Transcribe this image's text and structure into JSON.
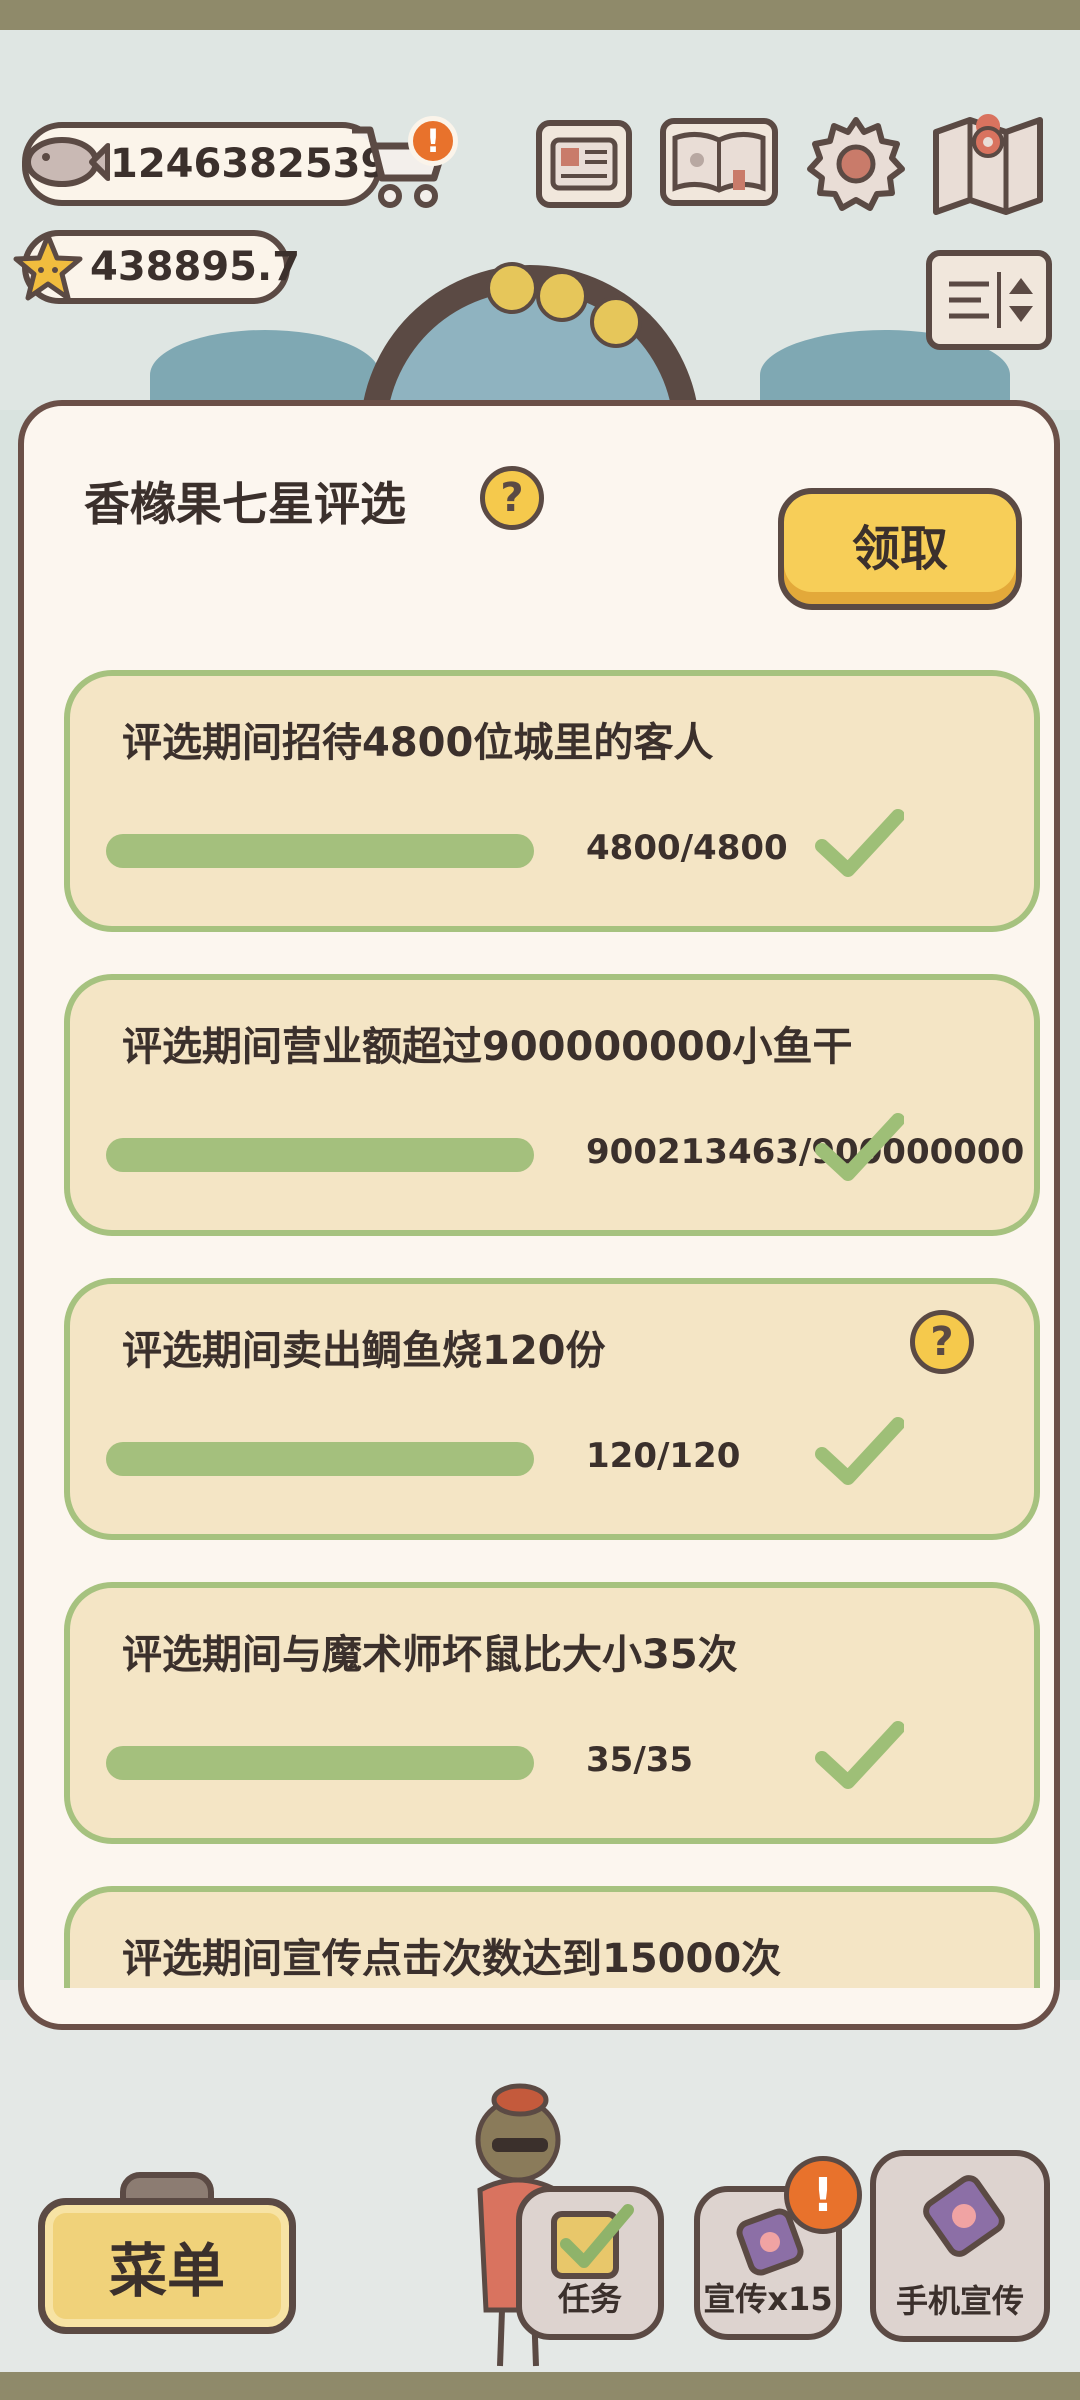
{
  "hud": {
    "fish_count": "1246382539",
    "star_count": "438895.7",
    "cart_alert": "!"
  },
  "icons": {
    "top_buttons": [
      "newspaper-icon",
      "album-icon",
      "settings-icon",
      "map-icon"
    ],
    "layout_toggle": "layout-toggle-icon"
  },
  "modal": {
    "title": "香橼果七星评选",
    "help": "?",
    "claim_label": "领取",
    "tasks": [
      {
        "title": "评选期间招待4800位城里的客人",
        "progress_text": "4800/4800",
        "progress": 1.0,
        "done": true
      },
      {
        "title": "评选期间营业额超过900000000小鱼干",
        "progress_text": "900213463/900000000",
        "progress": 1.0,
        "done": true
      },
      {
        "title": "评选期间卖出鲷鱼烧120份",
        "progress_text": "120/120",
        "progress": 1.0,
        "done": true,
        "help": "?"
      },
      {
        "title": "评选期间与魔术师坏鼠比大小35次",
        "progress_text": "35/35",
        "progress": 1.0,
        "done": true
      },
      {
        "title": "评选期间宣传点击次数达到15000次"
      }
    ]
  },
  "bottom": {
    "menu_label": "菜单",
    "task_label": "任务",
    "promote_label": "宣传x15",
    "phone_promote_label": "手机宣传",
    "promote_alert": "!"
  },
  "colors": {
    "card_border": "#a6c27f",
    "card_fill": "#f4e5c5",
    "progress_fill": "#a4c07d",
    "claim_button": "#f7ce58",
    "alert": "#e8722c"
  }
}
